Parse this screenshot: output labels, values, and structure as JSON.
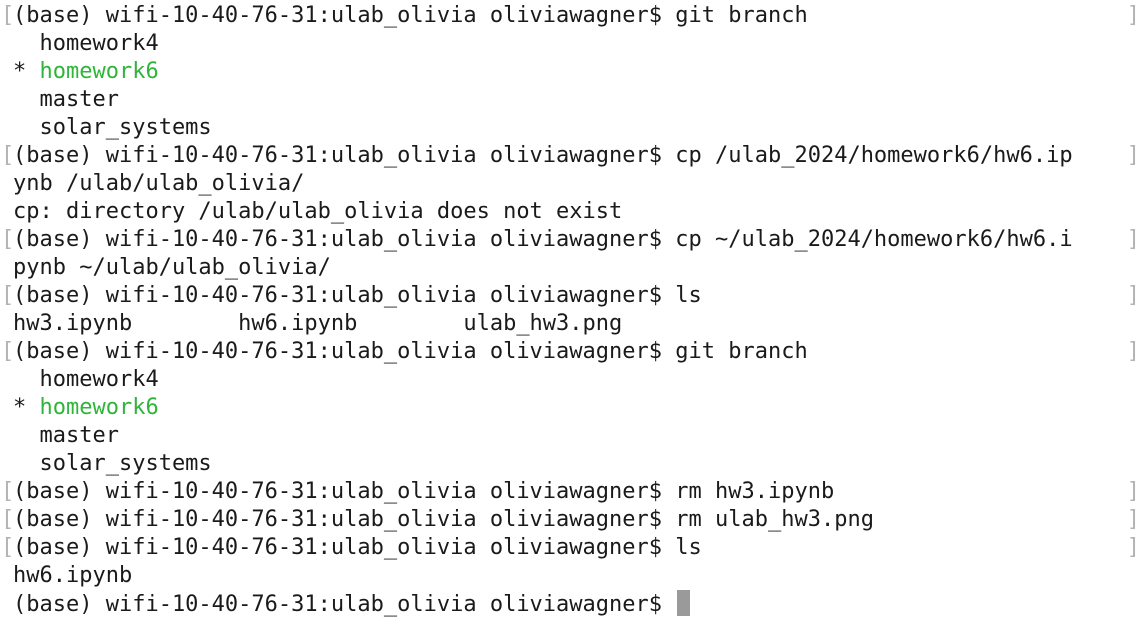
{
  "terminal": {
    "lines": [
      {
        "kind": "prompt",
        "text": "(base) wifi-10-40-76-31:ulab_olivia oliviawagner$ git branch",
        "marked": true
      },
      {
        "kind": "output",
        "text": "  homework4"
      },
      {
        "kind": "current-branch",
        "star": "* ",
        "branch": "homework6"
      },
      {
        "kind": "output",
        "text": "  master"
      },
      {
        "kind": "output",
        "text": "  solar_systems"
      },
      {
        "kind": "prompt",
        "text": "(base) wifi-10-40-76-31:ulab_olivia oliviawagner$ cp /ulab_2024/homework6/hw6.ip",
        "marked": true
      },
      {
        "kind": "output",
        "text": "ynb /ulab/ulab_olivia/"
      },
      {
        "kind": "output",
        "text": "cp: directory /ulab/ulab_olivia does not exist"
      },
      {
        "kind": "prompt",
        "text": "(base) wifi-10-40-76-31:ulab_olivia oliviawagner$ cp ~/ulab_2024/homework6/hw6.i",
        "marked": true
      },
      {
        "kind": "output",
        "text": "pynb ~/ulab/ulab_olivia/"
      },
      {
        "kind": "prompt",
        "text": "(base) wifi-10-40-76-31:ulab_olivia oliviawagner$ ls",
        "marked": true
      },
      {
        "kind": "output",
        "text": "hw3.ipynb        hw6.ipynb        ulab_hw3.png"
      },
      {
        "kind": "prompt",
        "text": "(base) wifi-10-40-76-31:ulab_olivia oliviawagner$ git branch",
        "marked": true
      },
      {
        "kind": "output",
        "text": "  homework4"
      },
      {
        "kind": "current-branch",
        "star": "* ",
        "branch": "homework6"
      },
      {
        "kind": "output",
        "text": "  master"
      },
      {
        "kind": "output",
        "text": "  solar_systems"
      },
      {
        "kind": "prompt",
        "text": "(base) wifi-10-40-76-31:ulab_olivia oliviawagner$ rm hw3.ipynb",
        "marked": true
      },
      {
        "kind": "prompt",
        "text": "(base) wifi-10-40-76-31:ulab_olivia oliviawagner$ rm ulab_hw3.png",
        "marked": true
      },
      {
        "kind": "prompt",
        "text": "(base) wifi-10-40-76-31:ulab_olivia oliviawagner$ ls",
        "marked": true
      },
      {
        "kind": "output",
        "text": "hw6.ipynb"
      },
      {
        "kind": "active-prompt",
        "text": "(base) wifi-10-40-76-31:ulab_olivia oliviawagner$ "
      }
    ],
    "mark_left": "[",
    "mark_right": "]"
  },
  "colors": {
    "background": "#ffffff",
    "text": "#1a1a1a",
    "current_branch": "#2fb53a",
    "marks": "#b3b3b3",
    "cursor": "#9a9a9a"
  }
}
